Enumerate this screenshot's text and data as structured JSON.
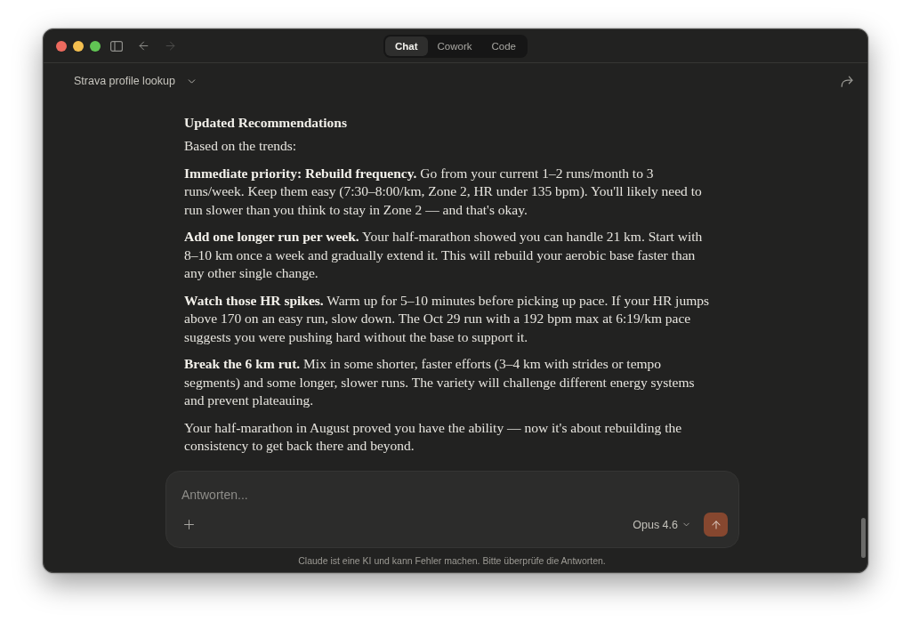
{
  "navigation": {
    "back_enabled": true,
    "forward_enabled": false
  },
  "mode_tabs": [
    {
      "label": "Chat",
      "selected": true
    },
    {
      "label": "Cowork",
      "selected": false
    },
    {
      "label": "Code",
      "selected": false
    }
  ],
  "conversation": {
    "title": "Strava profile lookup"
  },
  "message": {
    "heading": "Updated Recommendations",
    "paragraphs": [
      "Based on the trends:",
      "**Immediate priority: Rebuild frequency.** Go from your current 1–2 runs/month to 3 runs/week. Keep them easy (7:30–8:00/km, Zone 2, HR under 135 bpm). You'll likely need to run slower than you think to stay in Zone 2 — and that's okay.",
      "**Add one longer run per week.** Your half-marathon showed you can handle 21 km. Start with 8–10 km once a week and gradually extend it. This will rebuild your aerobic base faster than any other single change.",
      "**Watch those HR spikes.** Warm up for 5–10 minutes before picking up pace. If your HR jumps above 170 on an easy run, slow down. The Oct 29 run with a 192 bpm max at 6:19/km pace suggests you were pushing hard without the base to support it.",
      "**Break the 6 km rut.** Mix in some shorter, faster efforts (3–4 km with strides or tempo segments) and some longer, slower runs. The variety will challenge different energy systems and prevent plateauing.",
      "Your half-marathon in August proved you have the ability — now it's about rebuilding the consistency to get back there and beyond."
    ]
  },
  "composer": {
    "placeholder": "Antworten...",
    "model": "Opus 4.6"
  },
  "disclaimer": "Claude ist eine KI und kann Fehler machen. Bitte überprüfe die Antworten."
}
